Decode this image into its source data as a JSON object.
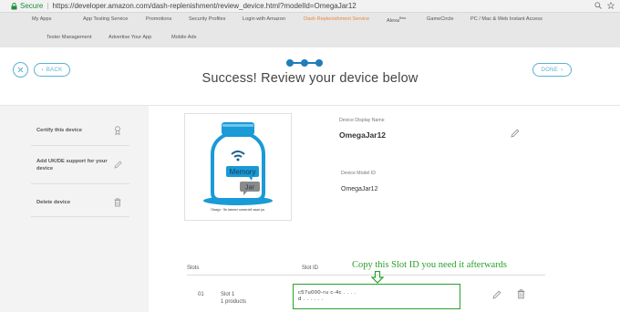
{
  "browser": {
    "secure_label": "Secure",
    "url": "https://developer.amazon.com/dash-replenishment/review_device.html?modelId=OmegaJar12"
  },
  "topnav": {
    "row1": [
      {
        "label": "My Apps",
        "active": false
      },
      {
        "label": "App Testing Service",
        "active": false
      },
      {
        "label": "Promotions",
        "active": false
      },
      {
        "label": "Security Profiles",
        "active": false
      },
      {
        "label": "Login with Amazon",
        "active": false
      },
      {
        "label": "Dash Replenishment Service",
        "active": true
      },
      {
        "label": "Alexa",
        "sup": "Beta",
        "active": false
      },
      {
        "label": "GameCircle",
        "active": false
      },
      {
        "label": "PC / Mac & Web Instant Access",
        "active": false
      }
    ],
    "row2": [
      {
        "label": "Tester Management"
      },
      {
        "label": "Advertise Your App"
      },
      {
        "label": "Mobile Ads"
      }
    ]
  },
  "header": {
    "back_label": "BACK",
    "done_label": "DONE",
    "title": "Success! Review your device below",
    "steps_total": 3,
    "steps_complete": 3
  },
  "sidebar": {
    "items": [
      {
        "label": "Certify this device",
        "icon": "certificate-icon"
      },
      {
        "label": "Add UK/DE support for your device",
        "icon": "pencil-icon"
      },
      {
        "label": "Delete device",
        "icon": "trash-icon"
      }
    ]
  },
  "device": {
    "image_labels": {
      "bubble1": "Memory",
      "bubble2": "Jar"
    },
    "image_caption": "Omega - An internet connected smart jar.",
    "display_name_label": "Device Display Name",
    "display_name": "OmegaJar12",
    "model_id_label": "Device Model ID",
    "model_id": "OmegaJar12"
  },
  "slots": {
    "col_slots": "Slots",
    "col_slot_id": "Slot ID",
    "rows": [
      {
        "num": "01",
        "name": "Slot 1",
        "products": "1 products",
        "slot_id_line1": "c57u000-ru c-4c . . . .",
        "slot_id_line2": "d . . . . . ."
      }
    ]
  },
  "annotation": "Copy this Slot ID you need it afterwards",
  "colors": {
    "accent": "#5bb0d8",
    "active_nav": "#e8873a",
    "annotation": "#2aa12a",
    "step": "#1f7dba"
  }
}
